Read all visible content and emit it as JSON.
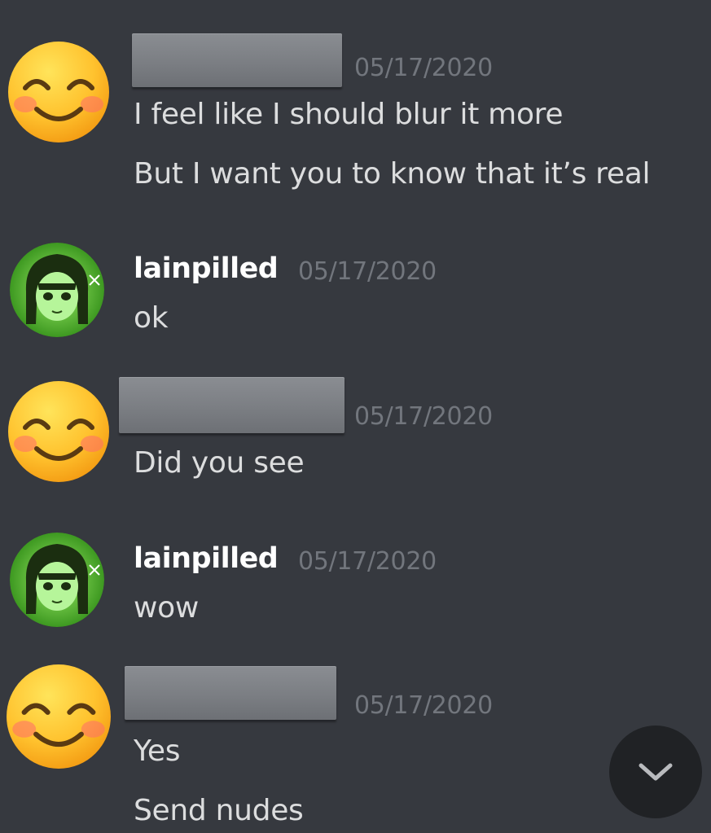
{
  "messages": [
    {
      "author_type": "emoji_user",
      "author": "",
      "timestamp": "05/17/2020",
      "lines": [
        "I feel like I should blur it  more",
        "But I want you to know that it’s real"
      ]
    },
    {
      "author_type": "lain_user",
      "author": "lainpilled",
      "timestamp": "05/17/2020",
      "lines": [
        "ok"
      ]
    },
    {
      "author_type": "emoji_user",
      "author": "",
      "timestamp": "05/17/2020",
      "lines": [
        "Did you see"
      ]
    },
    {
      "author_type": "lain_user",
      "author": "lainpilled",
      "timestamp": "05/17/2020",
      "lines": [
        "wow"
      ]
    },
    {
      "author_type": "emoji_user",
      "author": "",
      "timestamp": "05/17/2020",
      "lines": [
        "Yes",
        "Send nudes"
      ]
    }
  ],
  "icons": {
    "emoji_avatar": "smiling-face-emoji-icon",
    "lain_avatar": "anime-girl-avatar-icon",
    "jump_button": "chevron-down-icon"
  },
  "colors": {
    "background": "#36393f",
    "text": "#dcddde",
    "username": "#ffffff",
    "timestamp": "#72767d",
    "jump_button": "#202225"
  }
}
